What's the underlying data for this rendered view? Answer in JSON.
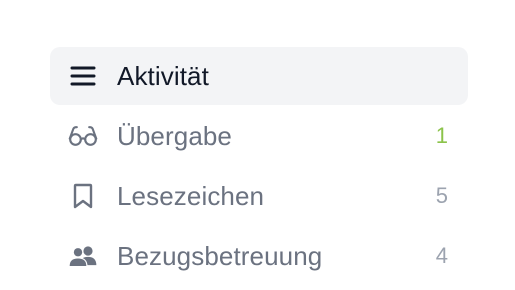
{
  "nav": {
    "items": [
      {
        "icon": "menu-lines-icon",
        "label": "Aktivität",
        "count": "",
        "active": true
      },
      {
        "icon": "glasses-icon",
        "label": "Übergabe",
        "count": "1",
        "active": false
      },
      {
        "icon": "bookmark-icon",
        "label": "Lesezeichen",
        "count": "5",
        "active": false
      },
      {
        "icon": "users-icon",
        "label": "Bezugsbetreuung",
        "count": "4",
        "active": false
      }
    ]
  },
  "colors": {
    "active_bg": "#f3f4f6",
    "active_text": "#111827",
    "inactive_text": "#6b7280",
    "count_default": "#9ca3af",
    "count_highlight": "#8bc34a"
  }
}
